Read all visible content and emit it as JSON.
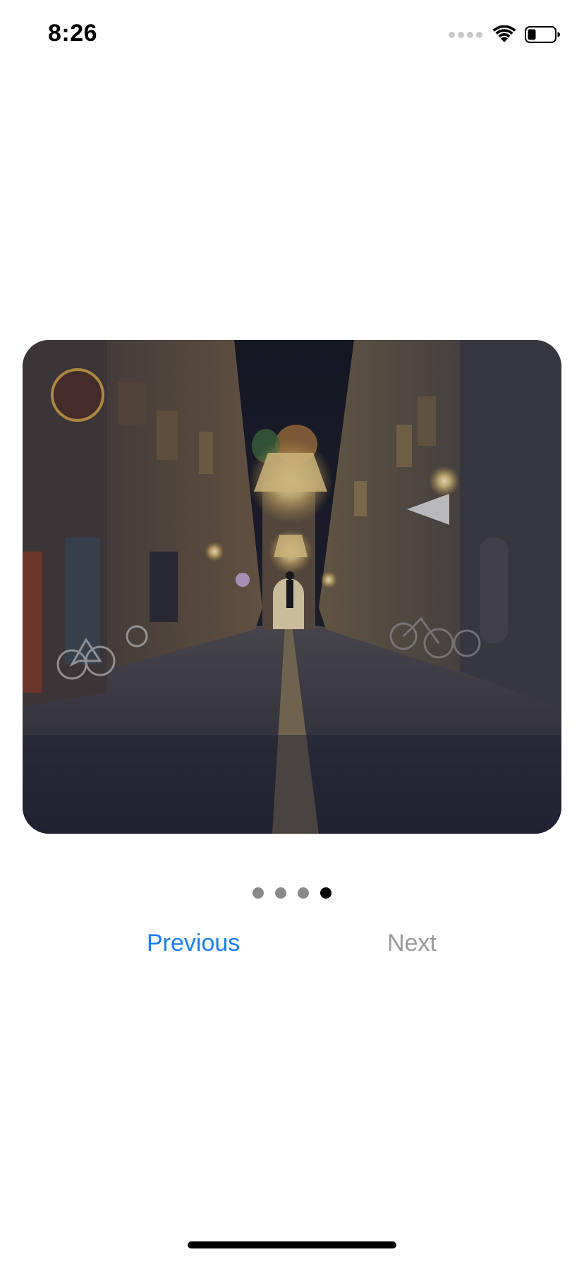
{
  "status_bar": {
    "time": "8:26"
  },
  "icons": {
    "wifi": "wifi-icon",
    "battery": "battery-icon",
    "signal": "cellular-signal-icon"
  },
  "gallery": {
    "page_count": 4,
    "current_page": 4
  },
  "navigation": {
    "previous_label": "Previous",
    "next_label": "Next"
  },
  "colors": {
    "accent": "#1a7ef2",
    "disabled": "#9a9a9a",
    "dot_inactive": "#8a8a8a",
    "dot_active": "#000000"
  }
}
